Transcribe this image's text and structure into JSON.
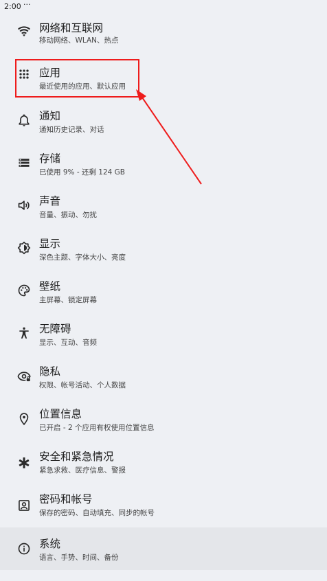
{
  "status_bar": {
    "time": "2:00",
    "dots": "···"
  },
  "settings": [
    {
      "title": "网络和互联网",
      "subtitle": "移动网络、WLAN、热点",
      "icon": "wifi-icon"
    },
    {
      "title": "应用",
      "subtitle": "最近使用的应用、默认应用",
      "icon": "apps-grid-icon"
    },
    {
      "title": "通知",
      "subtitle": "通知历史记录、对话",
      "icon": "bell-icon"
    },
    {
      "title": "存储",
      "subtitle": "已使用 9% - 还剩 124 GB",
      "icon": "storage-icon"
    },
    {
      "title": "声音",
      "subtitle": "音量、振动、勿扰",
      "icon": "volume-icon"
    },
    {
      "title": "显示",
      "subtitle": "深色主题、字体大小、亮度",
      "icon": "brightness-icon"
    },
    {
      "title": "壁纸",
      "subtitle": "主屏幕、锁定屏幕",
      "icon": "palette-icon"
    },
    {
      "title": "无障碍",
      "subtitle": "显示、互动、音频",
      "icon": "accessibility-icon"
    },
    {
      "title": "隐私",
      "subtitle": "权限、帐号活动、个人数据",
      "icon": "privacy-eye-icon"
    },
    {
      "title": "位置信息",
      "subtitle": "已开启 - 2 个应用有权使用位置信息",
      "icon": "location-pin-icon"
    },
    {
      "title": "安全和紧急情况",
      "subtitle": "紧急求救、医疗信息、警报",
      "icon": "emergency-asterisk-icon"
    },
    {
      "title": "密码和帐号",
      "subtitle": "保存的密码、自动填充、同步的帐号",
      "icon": "account-box-icon"
    },
    {
      "title": "系统",
      "subtitle": "语言、手势、时间、备份",
      "icon": "info-icon"
    }
  ],
  "colors": {
    "background": "#eef0f4",
    "highlight": "#ee1c1c",
    "selected_row": "#e4e6ea"
  }
}
